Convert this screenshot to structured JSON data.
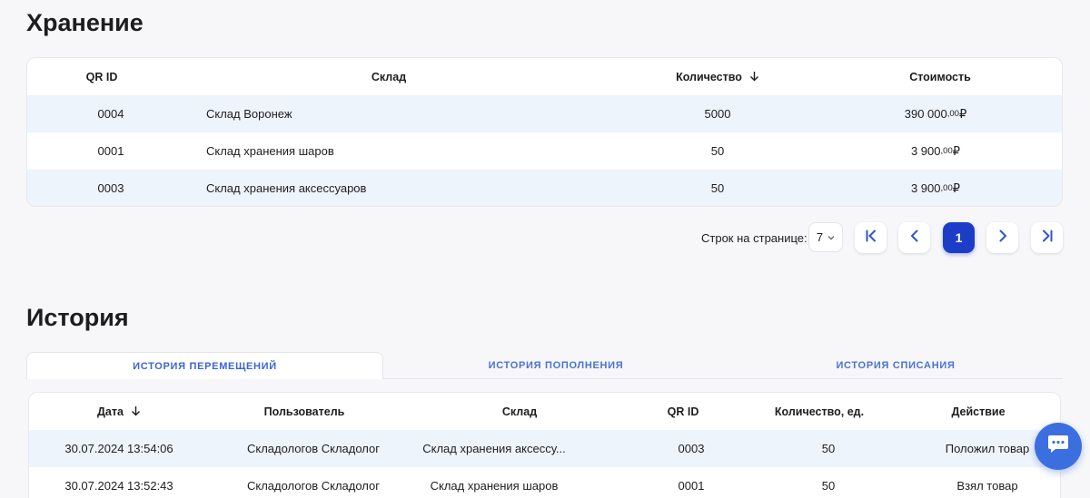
{
  "storage": {
    "title": "Хранение",
    "columns": {
      "qr_id": "QR ID",
      "warehouse": "Склад",
      "quantity": "Количество",
      "cost": "Стоимость"
    },
    "rows": [
      {
        "qr_id": "0004",
        "warehouse": "Склад Воронеж",
        "quantity": "5000",
        "cost_main": "390 000",
        "cost_cents": ",00",
        "currency": " ₽"
      },
      {
        "qr_id": "0001",
        "warehouse": "Склад хранения шаров",
        "quantity": "50",
        "cost_main": "3 900",
        "cost_cents": ",00",
        "currency": " ₽"
      },
      {
        "qr_id": "0003",
        "warehouse": "Склад хранения аксессуаров",
        "quantity": "50",
        "cost_main": "3 900",
        "cost_cents": ",00",
        "currency": " ₽"
      }
    ]
  },
  "pagination": {
    "rows_label": "Строк на странице:",
    "rows_value": "7",
    "current_page": "1"
  },
  "history": {
    "title": "История",
    "tabs": [
      {
        "label": "ИСТОРИЯ ПЕРЕМЕЩЕНИЙ",
        "active": true
      },
      {
        "label": "ИСТОРИЯ ПОПОЛНЕНИЯ",
        "active": false
      },
      {
        "label": "ИСТОРИЯ СПИСАНИЯ",
        "active": false
      }
    ],
    "columns": {
      "date": "Дата",
      "user": "Пользователь",
      "warehouse": "Склад",
      "qr_id": "QR ID",
      "quantity": "Количество, ед.",
      "action": "Действие"
    },
    "rows": [
      {
        "date": "30.07.2024 13:54:06",
        "user": "Складологов Складолог",
        "warehouse": "Склад хранения аксессу...",
        "qr_id": "0003",
        "quantity": "50",
        "action": "Положил товар"
      },
      {
        "date": "30.07.2024 13:52:43",
        "user": "Складологов Складолог",
        "warehouse": "Склад хранения шаров",
        "qr_id": "0001",
        "quantity": "50",
        "action": "Взял товар"
      }
    ]
  },
  "icons": {
    "sort": "arrow-down-icon",
    "first": "first-page-icon",
    "prev": "chevron-left-icon",
    "next": "chevron-right-icon",
    "last": "last-page-icon",
    "chat": "chat-icon"
  },
  "colors": {
    "accent": "#1c3ec7",
    "tab_text": "#4a72d8",
    "row_highlight": "#eef4fc",
    "chat_button": "#3b6fe0"
  }
}
